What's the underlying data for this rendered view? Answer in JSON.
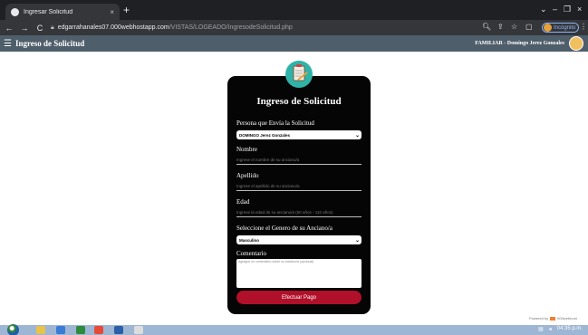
{
  "browser": {
    "tab_title": "Ingresar Solicitud",
    "tab_close": "×",
    "new_tab": "+",
    "url_host": "edgarrahanales07.000webhostapp.com",
    "url_path": "/VISTAS/LOGEADO/IngresodeSolicitud.php",
    "incognito_label": "Incógnito",
    "win_min": "–",
    "win_max": "❐",
    "win_close": "×",
    "win_menu": "⌄"
  },
  "app": {
    "title": "Ingreso de Solicitud",
    "user": "FAMILIAR - Domingo Jerez Gonzales"
  },
  "form": {
    "title": "Ingreso de Solicitud",
    "sender_label": "Persona que Envía la Solicitud",
    "sender_value": "DOMINGO Jerez Gonzales",
    "name_label": "Nombre",
    "name_placeholder": "Ingrese el nombre de su anciano/a",
    "surname_label": "Apellido",
    "surname_placeholder": "Ingrese el apellido de su anciano/a",
    "age_label": "Edad",
    "age_placeholder": "Ingrese la edad de su anciano/a (60 años - 110 años)",
    "gender_label": "Seleccione el Genero de su Anciano/a",
    "gender_value": "Masculino",
    "comment_label": "Comentario",
    "comment_placeholder": "Agregue un comentario sobre su anciano/a (opcional)",
    "submit_label": "Efectuar Pago"
  },
  "footer": {
    "hosting_text": "Powered by",
    "hosting_brand": "000webhost"
  },
  "taskbar": {
    "time": "04:35 p.m."
  },
  "colors": {
    "header": "#4e5e6a",
    "card": "#050505",
    "submit": "#b0102a",
    "taskbar": "#9db6d4"
  }
}
